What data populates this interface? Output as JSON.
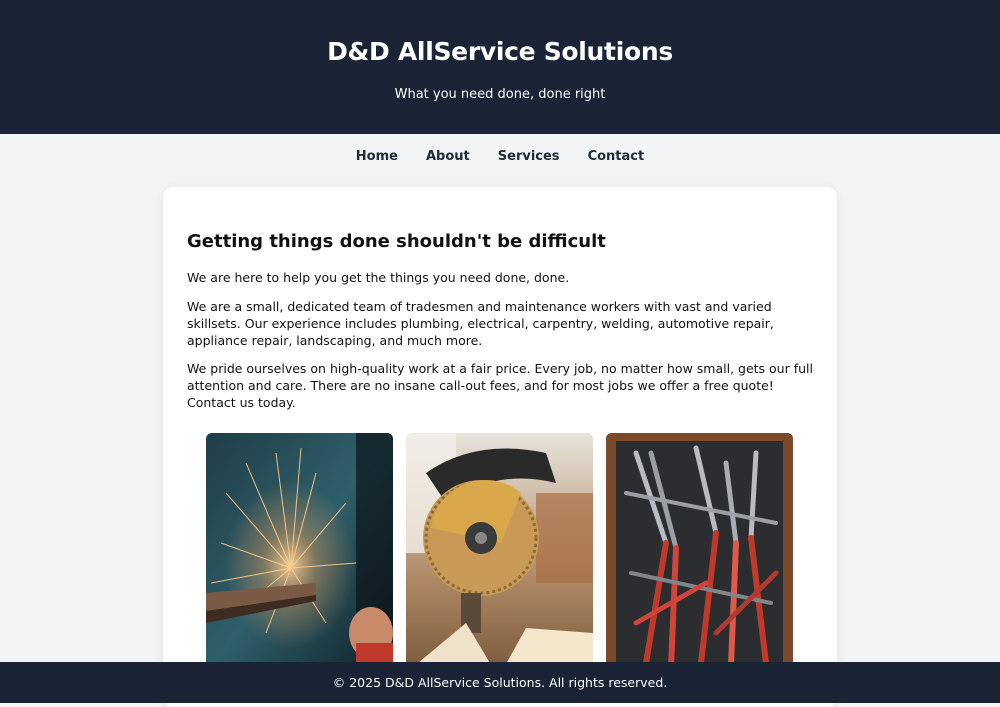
{
  "header": {
    "title": "D&D AllService Solutions",
    "tagline": "What you need done, done right"
  },
  "nav": {
    "items": [
      "Home",
      "About",
      "Services",
      "Contact"
    ]
  },
  "main": {
    "heading": "Getting things done shouldn't be difficult",
    "paragraphs": [
      "We are here to help you get the things you need done, done.",
      "We are a small, dedicated team of tradesmen and maintenance workers with vast and varied skillsets. Our experience includes plumbing, electrical, carpentry, welding, automotive repair, appliance repair, landscaping, and much more.",
      "We pride ourselves on high-quality work at a fair price. Every job, no matter how small, gets our full attention and care. There are no insane call-out fees, and for most jobs we offer a free quote!"
    ],
    "contact_line": "Contact us today."
  },
  "gallery": {
    "images": [
      "grinder-sparks-photo",
      "circular-saw-photo",
      "pliers-toolbox-photo"
    ]
  },
  "footer": {
    "copyright": "© 2025 D&D AllService Solutions. All rights reserved."
  },
  "colors": {
    "header_bg": "#1b2336",
    "page_bg": "#f3f4f6",
    "card_bg": "#ffffff"
  }
}
